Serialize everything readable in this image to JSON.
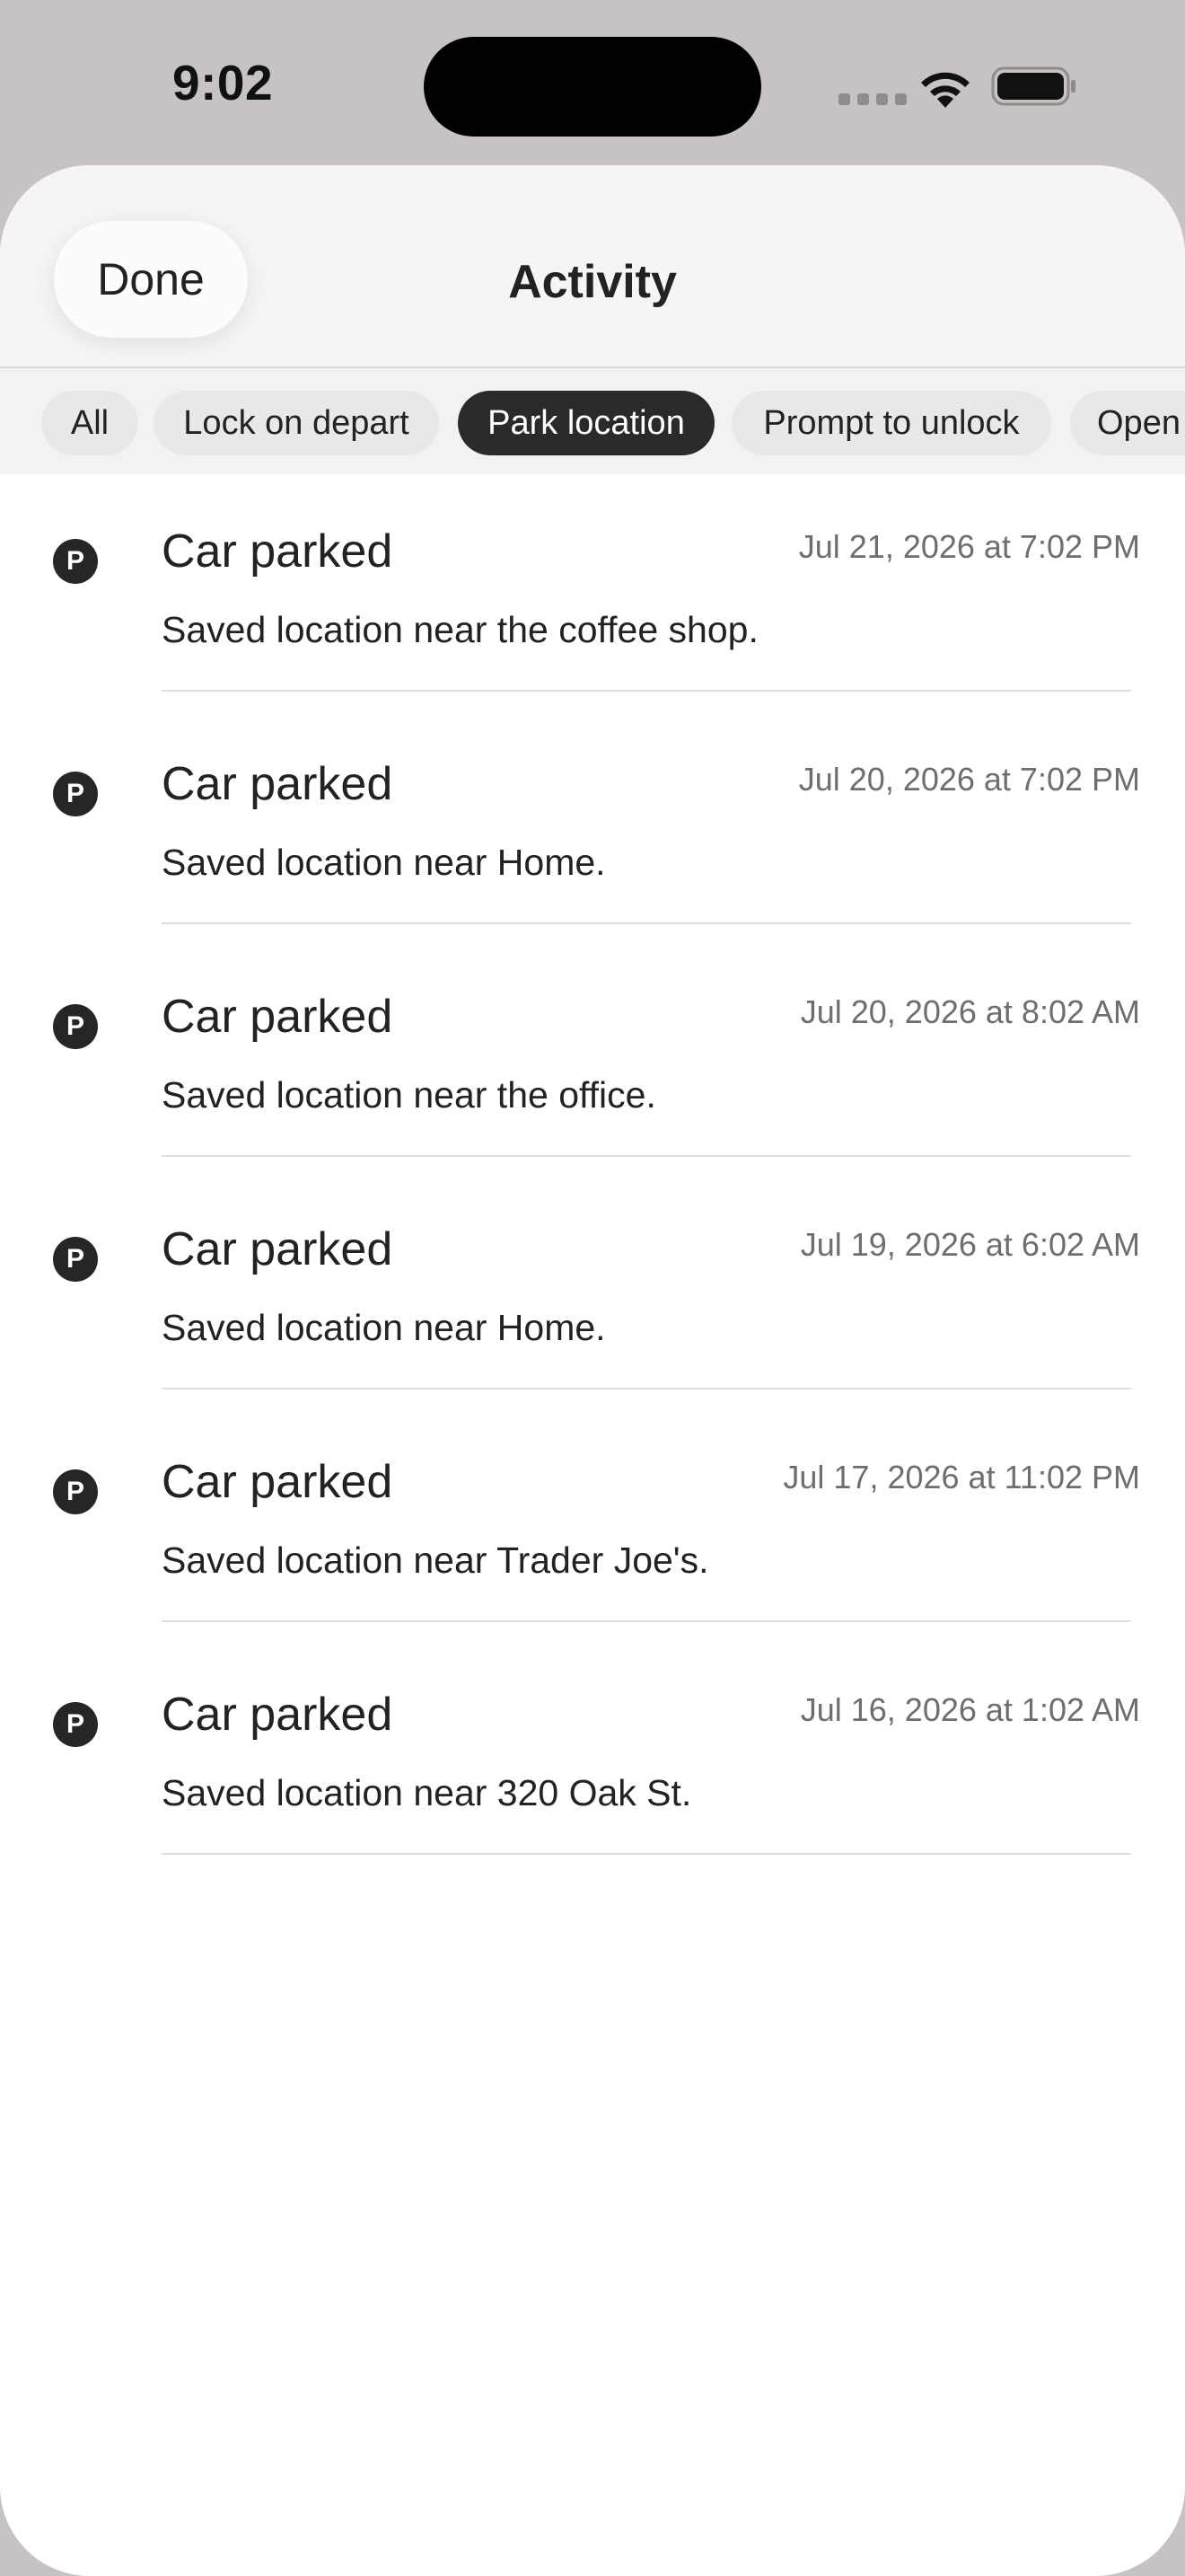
{
  "status_bar": {
    "time": "9:02"
  },
  "header": {
    "done_label": "Done",
    "title": "Activity"
  },
  "filters": [
    {
      "label": "All",
      "active": false
    },
    {
      "label": "Lock on depart",
      "active": false
    },
    {
      "label": "Park location",
      "active": true
    },
    {
      "label": "Prompt to unlock",
      "active": false
    },
    {
      "label": "Open",
      "active": false
    }
  ],
  "activity": [
    {
      "icon": "P",
      "title": "Car parked",
      "time": "Jul 21, 2026 at 7:02 PM",
      "description": "Saved location near the coffee shop."
    },
    {
      "icon": "P",
      "title": "Car parked",
      "time": "Jul 20, 2026 at 7:02 PM",
      "description": "Saved location near Home."
    },
    {
      "icon": "P",
      "title": "Car parked",
      "time": "Jul 20, 2026 at 8:02 AM",
      "description": "Saved location near the office."
    },
    {
      "icon": "P",
      "title": "Car parked",
      "time": "Jul 19, 2026 at 6:02 AM",
      "description": "Saved location near Home."
    },
    {
      "icon": "P",
      "title": "Car parked",
      "time": "Jul 17, 2026 at 11:02 PM",
      "description": "Saved location near Trader Joe's."
    },
    {
      "icon": "P",
      "title": "Car parked",
      "time": "Jul 16, 2026 at 1:02 AM",
      "description": "Saved location near 320 Oak St."
    }
  ],
  "colors": {
    "background": "#c7c3c2",
    "sheet": "#ffffff",
    "header": "#f7f5f4",
    "chip": "#e9e7ea",
    "chip_active": "#2a2a2a",
    "timestamp": "#6e6e6e"
  }
}
